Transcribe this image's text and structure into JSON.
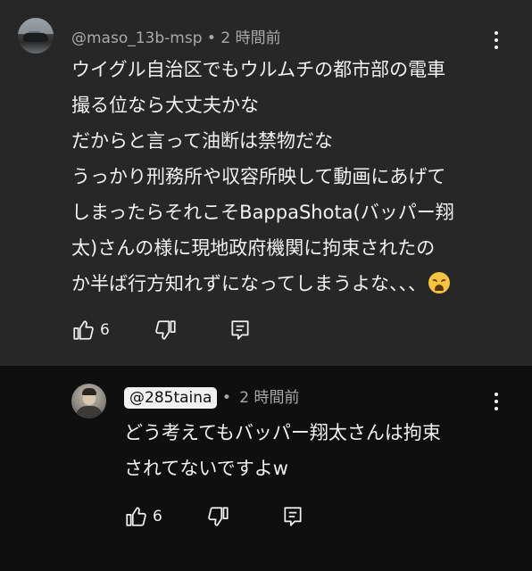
{
  "comment": {
    "handle": "@maso_13b-msp",
    "time": "2 時間前",
    "lines": [
      "ウイグル自治区でもウルムチの都市部の電車",
      "撮る位なら大丈夫かな",
      "だからと言って油断は禁物だな",
      "うっかり刑務所や収容所映して動画にあげて",
      "しまったらそれこそBappaShota(バッパー翔",
      "太)さんの様に現地政府機関に拘束されたの",
      "か半ば行方知れずになってしまうよな、、、"
    ],
    "emoji": "weary-face",
    "likes": "6",
    "background": "#272727"
  },
  "reply": {
    "handle": "@285taina",
    "time": "2 時間前",
    "lines": [
      "どう考えてもバッパー翔太さんは拘束",
      "されてないですよw"
    ],
    "likes": "6",
    "background": "#0f0f0f"
  },
  "icons": {
    "like": "thumbs-up-icon",
    "dislike": "thumbs-down-icon",
    "reply": "reply-icon",
    "more": "more-vert-icon"
  }
}
